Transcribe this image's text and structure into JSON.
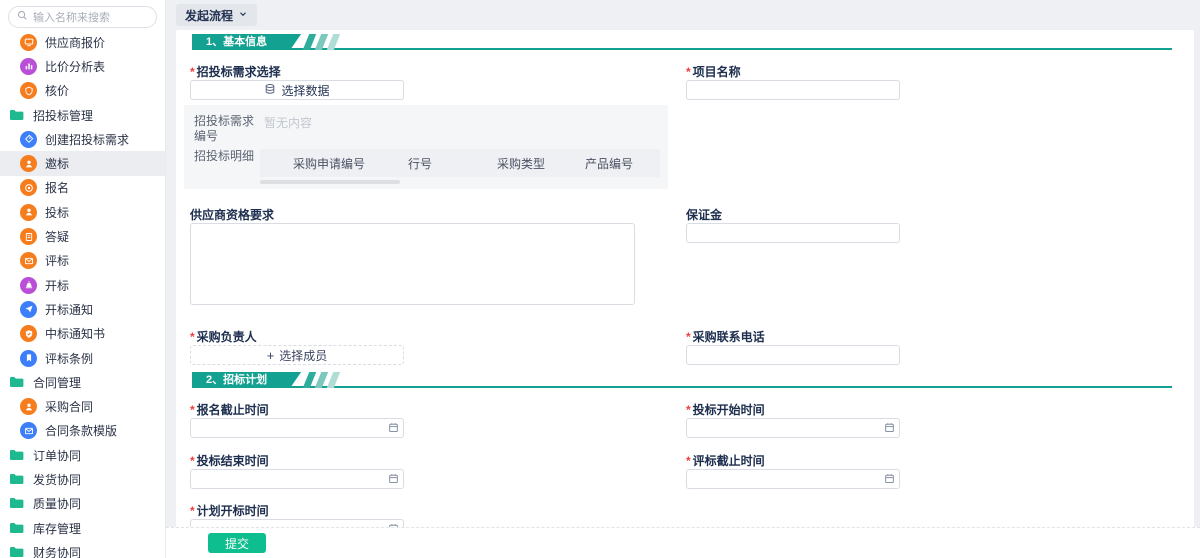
{
  "colors": {
    "accent_teal": "#13A191",
    "submit_green": "#0FBE8E",
    "orange": "#F67D1E",
    "purple": "#B94FD6",
    "blue": "#3D7FFB",
    "folder_green": "#1EB98F"
  },
  "sidebar": {
    "search_placeholder": "输入名称来搜索",
    "items": [
      {
        "label": "供应商报价",
        "icon": "screen-icon",
        "color": "#F67D1E",
        "type": "child",
        "selected": false
      },
      {
        "label": "比价分析表",
        "icon": "bar-chart-icon",
        "color": "#B94FD6",
        "type": "child",
        "selected": false
      },
      {
        "label": "核价",
        "icon": "shield-icon",
        "color": "#F67D1E",
        "type": "child",
        "selected": false
      },
      {
        "label": "招投标管理",
        "icon": "folder-icon",
        "type": "group",
        "selected": false
      },
      {
        "label": "创建招投标需求",
        "icon": "tag-icon",
        "color": "#3D7FFB",
        "type": "child",
        "selected": false
      },
      {
        "label": "邀标",
        "icon": "person-icon",
        "color": "#F67D1E",
        "type": "child",
        "selected": true
      },
      {
        "label": "报名",
        "icon": "target-icon",
        "color": "#F67D1E",
        "type": "child",
        "selected": false
      },
      {
        "label": "投标",
        "icon": "person-icon",
        "color": "#F67D1E",
        "type": "child",
        "selected": false
      },
      {
        "label": "答疑",
        "icon": "document-icon",
        "color": "#F67D1E",
        "type": "child",
        "selected": false
      },
      {
        "label": "评标",
        "icon": "mail-icon",
        "color": "#F67D1E",
        "type": "child",
        "selected": false
      },
      {
        "label": "开标",
        "icon": "bell-icon",
        "color": "#B94FD6",
        "type": "child",
        "selected": false
      },
      {
        "label": "开标通知",
        "icon": "send-icon",
        "color": "#3D7FFB",
        "type": "child",
        "selected": false
      },
      {
        "label": "中标通知书",
        "icon": "shield-check-icon",
        "color": "#F67D1E",
        "type": "child",
        "selected": false
      },
      {
        "label": "评标条例",
        "icon": "bookmark-icon",
        "color": "#3D7FFB",
        "type": "child",
        "selected": false
      },
      {
        "label": "合同管理",
        "icon": "folder-icon",
        "type": "group",
        "selected": false
      },
      {
        "label": "采购合同",
        "icon": "person-icon",
        "color": "#F67D1E",
        "type": "child",
        "selected": false
      },
      {
        "label": "合同条款模版",
        "icon": "mail-icon",
        "color": "#3D7FFB",
        "type": "child",
        "selected": false
      },
      {
        "label": "订单协同",
        "icon": "folder-icon",
        "type": "group",
        "selected": false
      },
      {
        "label": "发货协同",
        "icon": "folder-icon",
        "type": "group",
        "selected": false
      },
      {
        "label": "质量协同",
        "icon": "folder-icon",
        "type": "group",
        "selected": false
      },
      {
        "label": "库存管理",
        "icon": "folder-icon",
        "type": "group",
        "selected": false
      },
      {
        "label": "财务协同",
        "icon": "folder-icon",
        "type": "group",
        "selected": false
      }
    ]
  },
  "topbar": {
    "launch_label": "发起流程"
  },
  "form": {
    "section1_title": "1、基本信息",
    "section2_title": "2、招标计划",
    "select_data": {
      "label": "招投标需求选择",
      "required": true,
      "button_label": "选择数据"
    },
    "project_name": {
      "label": "项目名称",
      "required": true,
      "value": ""
    },
    "panel": {
      "requirement_no_label": "招投标需求编号",
      "requirement_no_value": "暂无内容",
      "detail_label": "招投标明细",
      "table_headers": [
        "采购申请编号",
        "行号",
        "采购类型",
        "产品编号"
      ]
    },
    "supplier_qualification": {
      "label": "供应商资格要求",
      "value": ""
    },
    "deposit": {
      "label": "保证金",
      "value": ""
    },
    "purchaser": {
      "label": "采购负责人",
      "required": true,
      "button_label": "选择成员"
    },
    "contact_phone": {
      "label": "采购联系电话",
      "required": true,
      "value": ""
    },
    "dates": {
      "signup": {
        "label": "报名截止时间",
        "required": true,
        "value": ""
      },
      "bid_start": {
        "label": "投标开始时间",
        "required": true,
        "value": ""
      },
      "bid_end": {
        "label": "投标结束时间",
        "required": true,
        "value": ""
      },
      "eval_deadline": {
        "label": "评标截止时间",
        "required": true,
        "value": ""
      },
      "plan_open": {
        "label": "计划开标时间",
        "required": true,
        "value": ""
      }
    }
  },
  "footer": {
    "submit_label": "提交"
  }
}
